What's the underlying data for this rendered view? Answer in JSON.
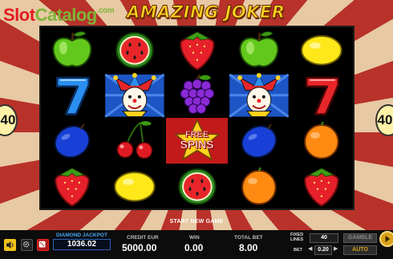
{
  "watermark": {
    "part1": "Slot",
    "part2": "Catalog",
    "part3": ".com"
  },
  "game_title": "AMAZING JOKER",
  "lines_badge": {
    "left": "40",
    "right": "40"
  },
  "reels": {
    "rows": [
      [
        "apple",
        "watermelon",
        "strawberry",
        "apple",
        "lemon"
      ],
      [
        "seven",
        "joker",
        "grapes",
        "joker",
        "seven"
      ],
      [
        "plum",
        "cherries",
        "free-spins",
        "plum",
        "orange"
      ],
      [
        "strawberry",
        "lemon",
        "watermelon",
        "orange",
        "strawberry"
      ]
    ],
    "free_spins_line1": "FREE",
    "free_spins_line2": "SPINS"
  },
  "message": "START NEW GAME",
  "panel": {
    "jackpot_label": "DIAMOND JACKPOT",
    "jackpot_value": "1036.02",
    "credit_label": "CREDIT EUR",
    "credit_value": "5000.00",
    "win_label": "WIN",
    "win_value": "0.00",
    "total_bet_label": "TOTAL BET",
    "total_bet_value": "8.00",
    "fixed_lines_label_1": "FIXED",
    "fixed_lines_label_2": "LINES",
    "fixed_lines_value": "40",
    "bet_label": "BET",
    "bet_value": "0.20",
    "gamble_label": "GAMBLE",
    "auto_label": "AUTO"
  },
  "colors": {
    "accent_yellow": "#ffd21f",
    "jackpot_blue": "#48a6f1",
    "panel_bg": "#0c0c0c",
    "auto_gold": "#d6a21b"
  }
}
